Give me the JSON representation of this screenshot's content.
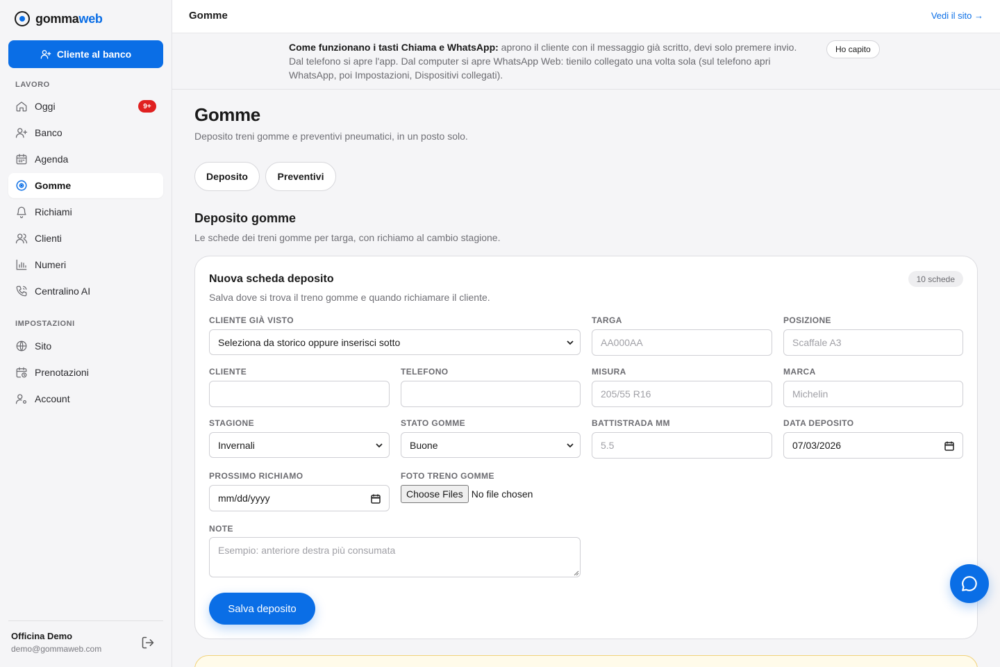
{
  "brand": {
    "name_part1": "gomma",
    "name_part2": "web",
    "accent_color": "#0a6ee6"
  },
  "sidebar": {
    "cta_label": "Cliente al banco",
    "sections": [
      {
        "label": "LAVORO"
      },
      {
        "label": "IMPOSTAZIONI"
      }
    ],
    "items": [
      {
        "label": "Oggi",
        "icon": "home-icon",
        "badge": "9+"
      },
      {
        "label": "Banco",
        "icon": "user-plus-icon"
      },
      {
        "label": "Agenda",
        "icon": "calendar-icon"
      },
      {
        "label": "Gomme",
        "icon": "tire-icon",
        "active": true
      },
      {
        "label": "Richiami",
        "icon": "bell-icon"
      },
      {
        "label": "Clienti",
        "icon": "users-icon"
      },
      {
        "label": "Numeri",
        "icon": "bar-chart-icon"
      },
      {
        "label": "Centralino AI",
        "icon": "phone-icon"
      },
      {
        "label": "Sito",
        "icon": "globe-icon"
      },
      {
        "label": "Prenotazioni",
        "icon": "calendar-clock-icon"
      },
      {
        "label": "Account",
        "icon": "user-settings-icon"
      }
    ],
    "user": {
      "name": "Officina Demo",
      "email": "demo@gommaweb.com"
    }
  },
  "header": {
    "title": "Gomme",
    "link": "Vedi il sito →"
  },
  "banner": {
    "bold": "Come funzionano i tasti Chiama e WhatsApp:",
    "text": " aprono il cliente con il messaggio già scritto, devi solo premere invio. Dal telefono si apre l'app. Dal computer si apre WhatsApp Web: tienilo collegato una volta sola (sul telefono apri WhatsApp, poi Impostazioni, Dispositivi collegati).",
    "button": "Ho capito"
  },
  "page": {
    "title": "Gomme",
    "subtitle": "Deposito treni gomme e preventivi pneumatici, in un posto solo.",
    "tabs": [
      "Deposito",
      "Preventivi"
    ],
    "section_title": "Deposito gomme",
    "section_subtitle": "Le schede dei treni gomme per targa, con richiamo al cambio stagione."
  },
  "form": {
    "title": "Nuova scheda deposito",
    "subtitle": "Salva dove si trova il treno gomme e quando richiamare il cliente.",
    "count": "10 schede",
    "fields": {
      "cliente_visto": {
        "label": "CLIENTE GIÀ VISTO",
        "value": "Seleziona da storico oppure inserisci sotto"
      },
      "targa": {
        "label": "TARGA",
        "placeholder": "AA000AA"
      },
      "posizione": {
        "label": "POSIZIONE",
        "placeholder": "Scaffale A3"
      },
      "cliente": {
        "label": "CLIENTE",
        "placeholder": ""
      },
      "telefono": {
        "label": "TELEFONO",
        "placeholder": ""
      },
      "misura": {
        "label": "MISURA",
        "placeholder": "205/55 R16"
      },
      "marca": {
        "label": "MARCA",
        "placeholder": "Michelin"
      },
      "stagione": {
        "label": "STAGIONE",
        "value": "Invernali"
      },
      "stato": {
        "label": "STATO GOMME",
        "value": "Buone"
      },
      "battistrada": {
        "label": "BATTISTRADA MM",
        "placeholder": "5.5"
      },
      "data_deposito": {
        "label": "DATA DEPOSITO",
        "value": "07/03/2026"
      },
      "richiamo": {
        "label": "PROSSIMO RICHIAMO",
        "value": "mm/dd/yyyy"
      },
      "foto": {
        "label": "FOTO TRENO GOMME",
        "button": "Choose Files",
        "status": "No file chosen"
      },
      "note": {
        "label": "NOTE",
        "placeholder": "Esempio: anteriore destra più consumata"
      }
    },
    "submit": "Salva deposito"
  }
}
